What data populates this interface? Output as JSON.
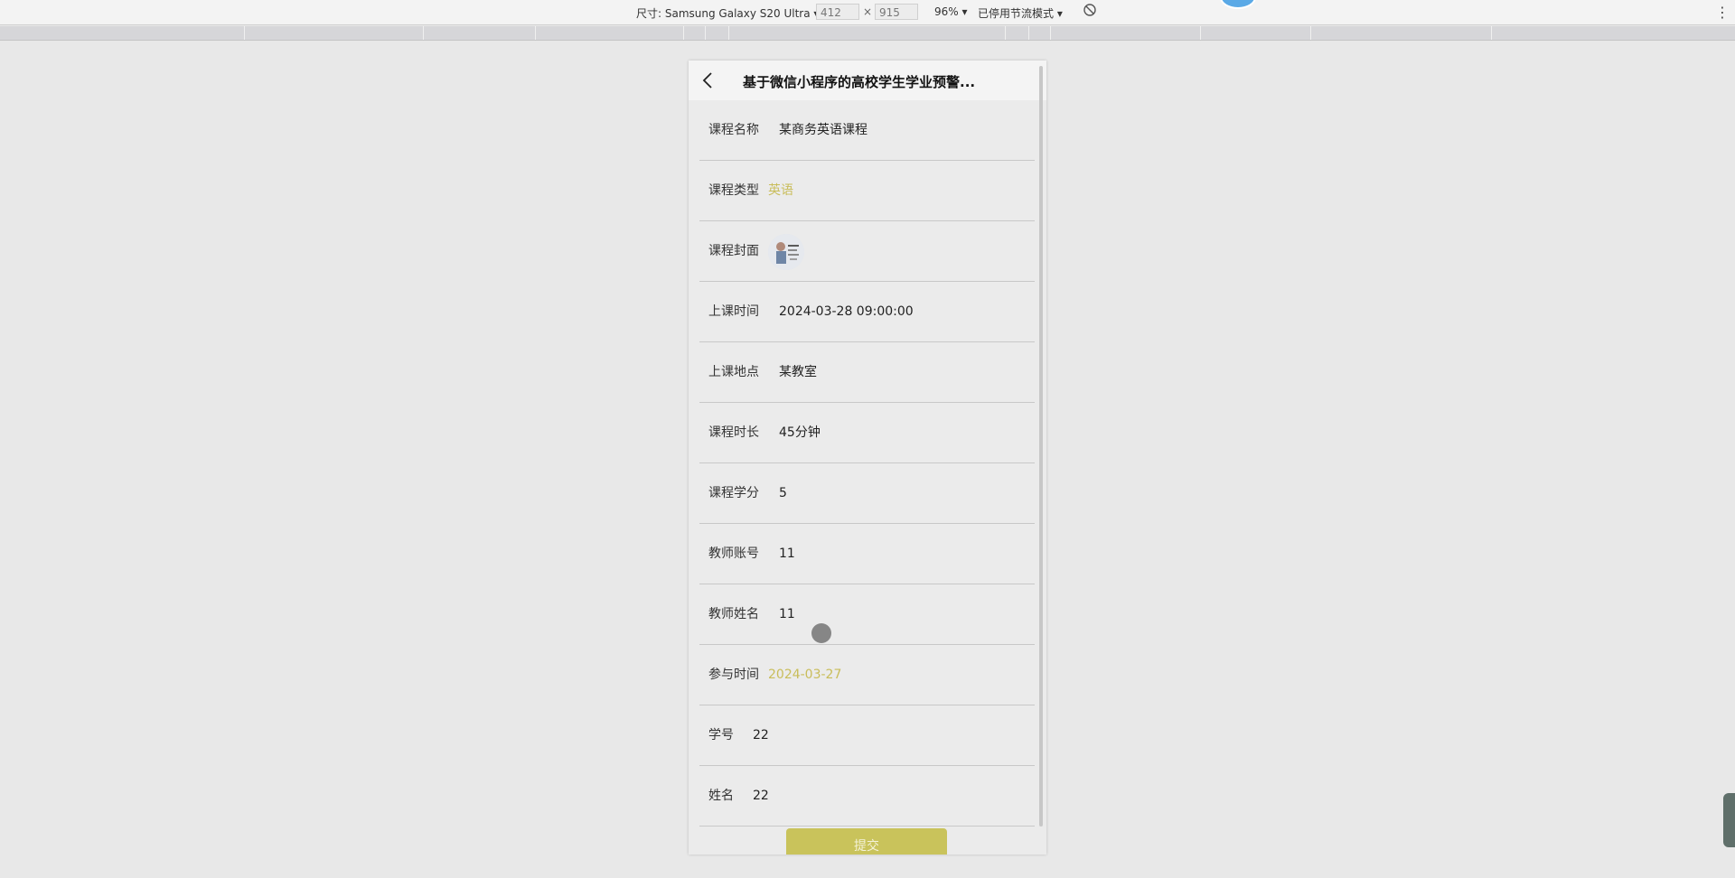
{
  "devtools": {
    "device_label": "尺寸: Samsung Galaxy S20 Ultra",
    "width": "412",
    "times": "×",
    "height": "915",
    "zoom": "96%",
    "throttle": "已停用节流模式"
  },
  "page": {
    "title": "基于微信小程序的高校学生学业预警..."
  },
  "form": {
    "course_name": {
      "label": "课程名称",
      "value": "某商务英语课程"
    },
    "course_type": {
      "label": "课程类型",
      "value": "英语"
    },
    "course_cover": {
      "label": "课程封面"
    },
    "class_time": {
      "label": "上课时间",
      "value": "2024-03-28 09:00:00"
    },
    "class_location": {
      "label": "上课地点",
      "value": "某教室"
    },
    "course_duration": {
      "label": "课程时长",
      "value": "45分钟"
    },
    "course_credit": {
      "label": "课程学分",
      "value": "5"
    },
    "teacher_account": {
      "label": "教师账号",
      "value": "11"
    },
    "teacher_name": {
      "label": "教师姓名",
      "value": "11"
    },
    "join_time": {
      "label": "参与时间",
      "value": "2024-03-27"
    },
    "student_id": {
      "label": "学号",
      "value": "22"
    },
    "student_name": {
      "label": "姓名",
      "value": "22"
    }
  },
  "submit_label": "提交",
  "colors": {
    "accent": "#c9c35b",
    "picker_text": "#c9bd5a"
  }
}
